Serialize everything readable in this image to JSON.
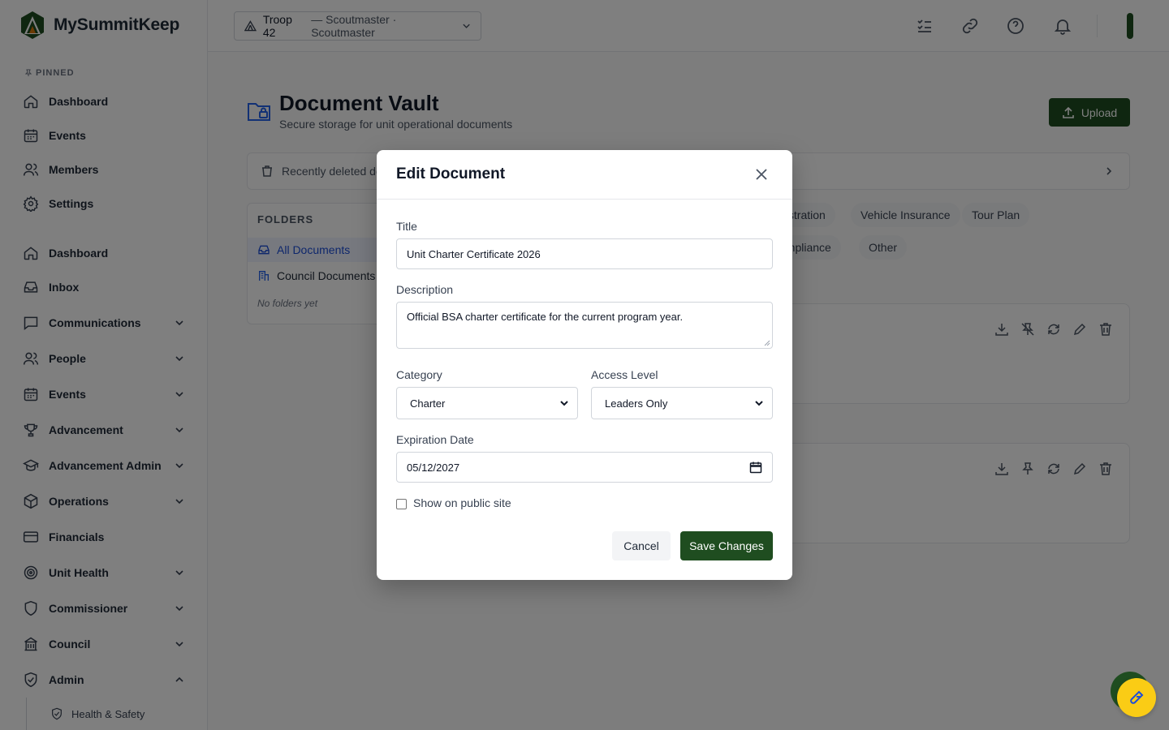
{
  "brand": {
    "name": "MySummitKeep"
  },
  "sidebar": {
    "pinned_label": "PINNED",
    "pinned": [
      {
        "label": "Dashboard",
        "icon": "home-icon"
      },
      {
        "label": "Events",
        "icon": "calendar-icon"
      },
      {
        "label": "Members",
        "icon": "users-icon"
      },
      {
        "label": "Settings",
        "icon": "gear-icon"
      }
    ],
    "items": [
      {
        "label": "Dashboard",
        "icon": "home-icon",
        "expandable": false
      },
      {
        "label": "Inbox",
        "icon": "inbox-icon",
        "expandable": false
      },
      {
        "label": "Communications",
        "icon": "message-icon",
        "expandable": true
      },
      {
        "label": "People",
        "icon": "users-icon",
        "expandable": true
      },
      {
        "label": "Events",
        "icon": "calendar-icon",
        "expandable": true
      },
      {
        "label": "Advancement",
        "icon": "trophy-icon",
        "expandable": true
      },
      {
        "label": "Advancement Admin",
        "icon": "graduation-cap-icon",
        "expandable": true
      },
      {
        "label": "Operations",
        "icon": "box-icon",
        "expandable": true
      },
      {
        "label": "Financials",
        "icon": "credit-card-icon",
        "expandable": false
      },
      {
        "label": "Unit Health",
        "icon": "target-icon",
        "expandable": true
      },
      {
        "label": "Commissioner",
        "icon": "shield-icon",
        "expandable": true
      },
      {
        "label": "Council",
        "icon": "building-icon",
        "expandable": true
      },
      {
        "label": "Admin",
        "icon": "shield-check-icon",
        "expandable": true,
        "expanded": true
      }
    ],
    "sub_items": [
      {
        "label": "Health & Safety",
        "icon": "shield-check-icon"
      }
    ]
  },
  "header": {
    "unit_selector": {
      "unit": "Troop 42",
      "role": "— Scoutmaster · Scoutmaster"
    },
    "icons": [
      "checklist-icon",
      "link-icon",
      "help-icon",
      "bell-icon"
    ]
  },
  "page": {
    "title": "Document Vault",
    "subtitle": "Secure storage for unit operational documents",
    "upload_label": "Upload",
    "recently_deleted": "Recently deleted do",
    "folders": {
      "heading": "FOLDERS",
      "all": "All Documents",
      "council": "Council Documents",
      "empty": "No folders yet"
    },
    "category_chips": [
      "gistration",
      "Vehicle Insurance",
      "Tour Plan",
      "ompliance",
      "Other"
    ]
  },
  "modal": {
    "title": "Edit Document",
    "title_label": "Title",
    "title_value": "Unit Charter Certificate 2026",
    "description_label": "Description",
    "description_value": "Official BSA charter certificate for the current program year.",
    "category_label": "Category",
    "category_value": "Charter",
    "access_label": "Access Level",
    "access_value": "Leaders Only",
    "expiration_label": "Expiration Date",
    "expiration_value": "05/12/2027",
    "public_label": "Show on public site",
    "public_checked": false,
    "cancel_label": "Cancel",
    "save_label": "Save Changes"
  },
  "colors": {
    "brand_green": "#1f4d20",
    "accent_blue": "#2563eb",
    "fab_yellow": "#facc15"
  }
}
